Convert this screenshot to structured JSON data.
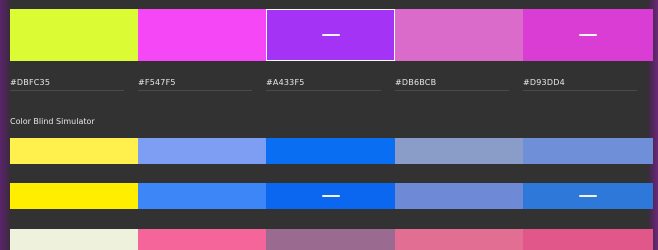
{
  "palette": {
    "swatches": [
      {
        "color": "#DBFC35",
        "hex": "#DBFC35"
      },
      {
        "color": "#F547F5",
        "hex": "#F547F5"
      },
      {
        "color": "#A433F5",
        "hex": "#A433F5"
      },
      {
        "color": "#DB6BCB",
        "hex": "#DB6BCB"
      },
      {
        "color": "#D93DD4",
        "hex": "#D93DD4"
      }
    ]
  },
  "simulator": {
    "title": "Color Blind Simulator",
    "rows": [
      {
        "colors": [
          "#FFF04E",
          "#7E9EF4",
          "#0A6EF3",
          "#8A9DC8",
          "#708FD9"
        ],
        "dashes": [
          false,
          false,
          false,
          false,
          false
        ]
      },
      {
        "colors": [
          "#FFEE00",
          "#3D86F8",
          "#0B67F0",
          "#6E89D6",
          "#2D78D9"
        ],
        "dashes": [
          false,
          false,
          true,
          false,
          true
        ]
      },
      {
        "colors": [
          "#EEF2DC",
          "#F5659A",
          "#9A6A91",
          "#E36E93",
          "#E1578A"
        ],
        "dashes": [
          false,
          false,
          false,
          false,
          false
        ]
      }
    ]
  }
}
